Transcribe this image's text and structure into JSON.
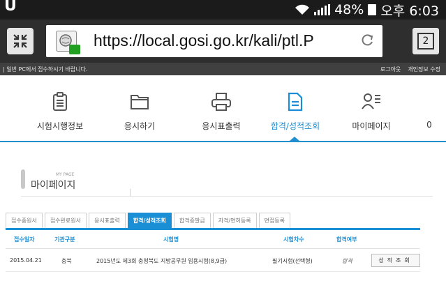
{
  "status_bar": {
    "left_icon": "u-badge",
    "wifi_icon": "wifi-icon",
    "signal_icon": "signal-icon",
    "battery_percent": "48%",
    "time": "오후 6:03"
  },
  "browser": {
    "url": "https://local.gosi.go.kr/kali/ptl.P",
    "tab_count": "2",
    "fullscreen_icon": "fullscreen-icon",
    "reload_icon": "reload-icon",
    "secure_lock_color": "#22a022"
  },
  "top_strip": {
    "notice": "| 일반 PC에서 접수하시기 바랍니다.",
    "logout": "로그아웃",
    "privacy": "개인정보 수정"
  },
  "main_nav": {
    "items": [
      {
        "label": "시험시행정보",
        "icon": "clipboard-icon"
      },
      {
        "label": "응시하기",
        "icon": "folder-icon"
      },
      {
        "label": "응시표출력",
        "icon": "printer-icon"
      },
      {
        "label": "합격/성적조회",
        "icon": "document-icon",
        "active": true
      },
      {
        "label": "마이페이지",
        "icon": "person-list-icon"
      },
      {
        "label": "0",
        "icon": ""
      }
    ],
    "accent_color": "#1f8fd0"
  },
  "page_title": {
    "small": "MY PAGE",
    "main": "마이페이지"
  },
  "sub_tabs": [
    {
      "label": "접수중원서",
      "active": false
    },
    {
      "label": "접수완료원서",
      "active": false
    },
    {
      "label": "응시표출력",
      "active": false
    },
    {
      "label": "합격/성적조회",
      "active": true
    },
    {
      "label": "합격증발급",
      "active": false
    },
    {
      "label": "자격/면허등록",
      "active": false
    },
    {
      "label": "면접등록",
      "active": false
    }
  ],
  "table": {
    "headers": [
      "접수일자",
      "기관구분",
      "시험명",
      "시험차수",
      "합격여부"
    ],
    "rows": [
      {
        "date": "2015.04.21",
        "agency": "충북",
        "exam_name": "2015년도 제3회 충청북도 지방공무원 임용시험(8,9급)",
        "round": "필기시험(선택형)",
        "result": "합격",
        "action": "성적조회"
      }
    ]
  }
}
